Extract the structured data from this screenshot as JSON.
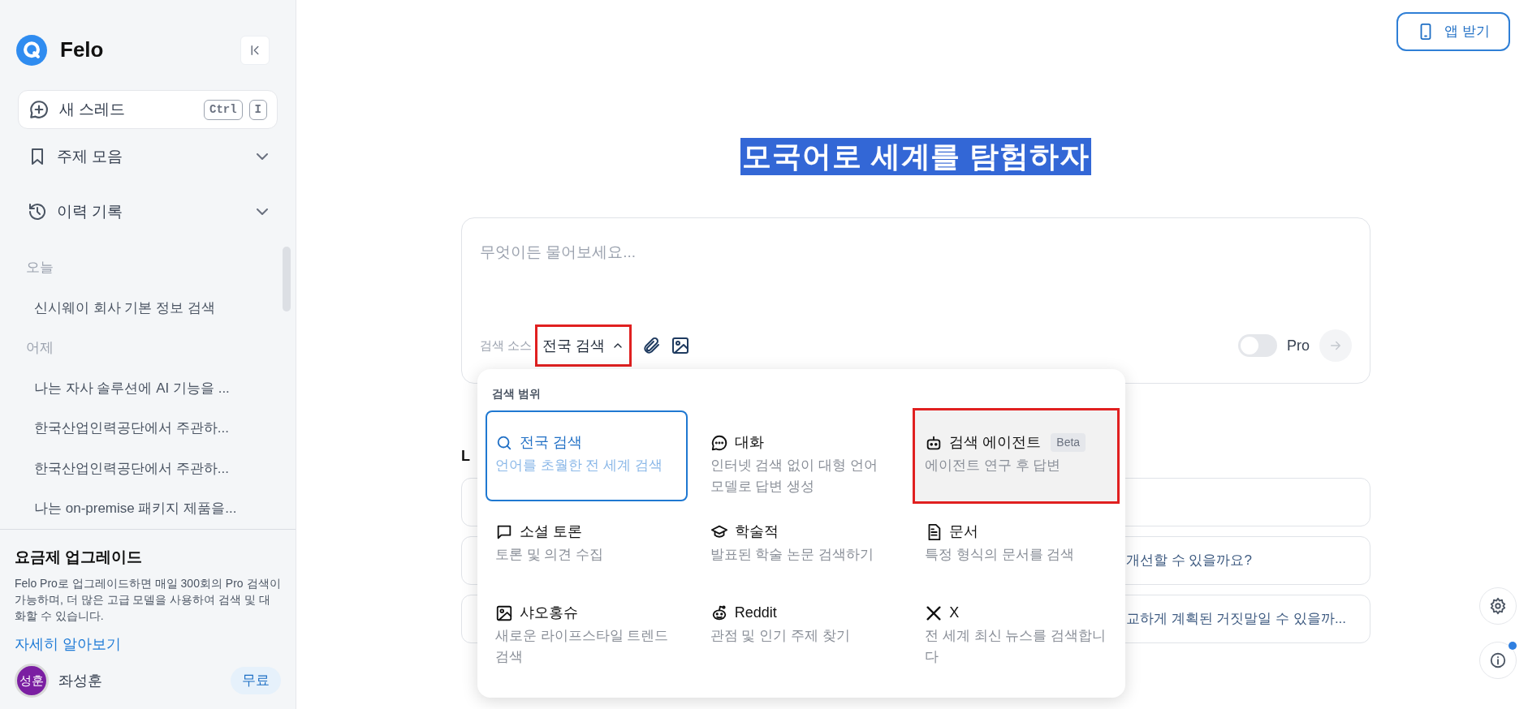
{
  "sidebar": {
    "brand": "Felo",
    "new_thread": {
      "label": "새 스레드",
      "keys": [
        "Ctrl",
        "I"
      ]
    },
    "nav": [
      {
        "kind": "bookmark",
        "label": "주제 모음",
        "expanded": false
      },
      {
        "kind": "history",
        "label": "이력 기록",
        "expanded": false
      }
    ],
    "history_groups": [
      {
        "label": "오늘",
        "items": [
          "신시웨이 회사 기본 정보 검색"
        ]
      },
      {
        "label": "어제",
        "items": [
          "나는 자사 솔루션에 AI 기능을 ...",
          "한국산업인력공단에서 주관하...",
          "한국산업인력공단에서 주관하...",
          "나는 on-premise 패키지 제품을..."
        ]
      }
    ],
    "upgrade": {
      "title": "요금제 업그레이드",
      "text": "Felo Pro로 업그레이드하면 매일 300회의 Pro 검색이 가능하며, 더 많은 고급 모델을 사용하여 검색 및 대화할 수 있습니다.",
      "link": "자세히 알아보기"
    },
    "user": {
      "initials": "성훈",
      "name": "좌성훈",
      "plan": "무료"
    }
  },
  "app_button": "앱 받기",
  "headline": "모국어로 세계를 탐험하자",
  "search": {
    "placeholder": "무엇이든 물어보세요...",
    "source_label": "검색 소스",
    "source": "전국 검색",
    "source_annotated": true,
    "pro": {
      "label": "Pro",
      "on": false
    }
  },
  "behind_heading": "L",
  "suggestions": [
    {
      "kind": "blank"
    },
    {
      "kind": "text",
      "text": "개선할 수 있을까요?"
    },
    {
      "kind": "text",
      "text": "교하게 계획된 거짓말일 수 있을까..."
    }
  ],
  "dropdown": {
    "title": "검색 범위",
    "options": [
      {
        "kind": "search",
        "label": "전국 검색",
        "desc": "언어를 초월한 전 세계 검색",
        "selected": true,
        "hovered": false,
        "annotated": false
      },
      {
        "kind": "chat",
        "label": "대화",
        "desc": "인터넷 검색 없이 대형 언어 모델로 답변 생성",
        "selected": false,
        "hovered": false,
        "annotated": false
      },
      {
        "kind": "robot",
        "label": "검색 에이전트",
        "badge": "Beta",
        "desc": "에이전트 연구 후 답변",
        "selected": false,
        "hovered": true,
        "annotated": true
      },
      {
        "kind": "message",
        "label": "소셜 토론",
        "desc": "토론 및 의견 수집",
        "selected": false,
        "hovered": false,
        "annotated": false
      },
      {
        "kind": "cap",
        "label": "학술적",
        "desc": "발표된 학술 논문 검색하기",
        "selected": false,
        "hovered": false,
        "annotated": false
      },
      {
        "kind": "document",
        "label": "문서",
        "desc": "특정 형식의 문서를 검색",
        "selected": false,
        "hovered": false,
        "annotated": false
      },
      {
        "kind": "image",
        "label": "샤오홍슈",
        "desc": "새로운 라이프스타일 트렌드 검색",
        "selected": false,
        "hovered": false,
        "annotated": false
      },
      {
        "kind": "reddit",
        "label": "Reddit",
        "desc": "관점 및 인기 주제 찾기",
        "selected": false,
        "hovered": false,
        "annotated": false
      },
      {
        "kind": "x",
        "label": "X",
        "desc": "전 세계 최신 뉴스를 검색합니다",
        "selected": false,
        "hovered": false,
        "annotated": false
      }
    ]
  },
  "info_notification": true
}
